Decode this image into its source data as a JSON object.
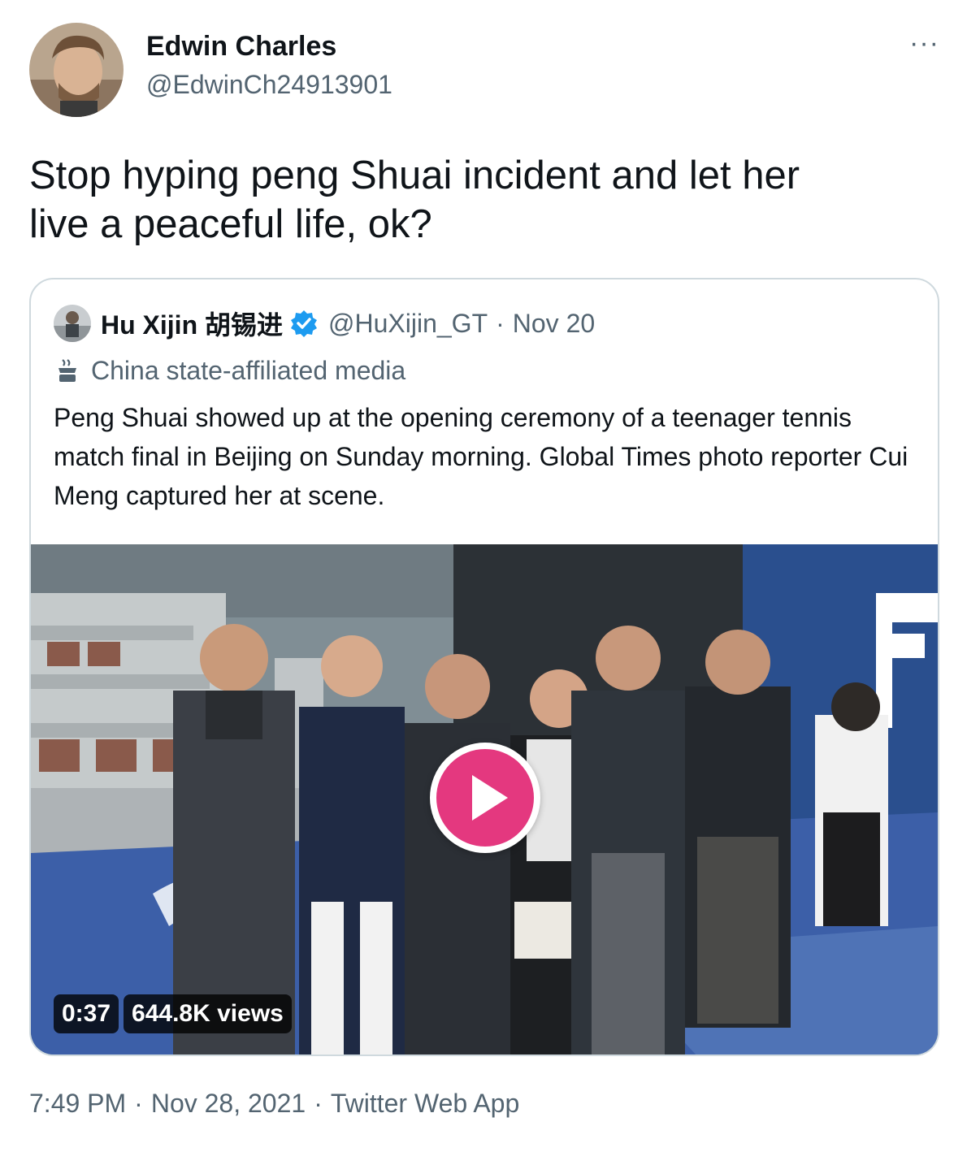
{
  "author": {
    "name": "Edwin Charles",
    "handle": "@EdwinCh24913901",
    "avatar_icon": "user-avatar-photo"
  },
  "more_icon": "more-options-icon",
  "more_label": "···",
  "tweet": {
    "text": "Stop hyping peng Shuai incident and let her\nlive a peaceful life, ok?"
  },
  "quoted": {
    "name": "Hu Xijin 胡锡进",
    "verified_icon": "verified-badge-icon",
    "handle": "@HuXijin_GT",
    "separator": "·",
    "date": "Nov 20",
    "label_icon": "state-media-icon",
    "label": "China state-affiliated media",
    "text": "Peng Shuai showed up at the opening ceremony of a teenager tennis match final in Beijing on Sunday morning. Global Times photo reporter Cui Meng captured her at scene.",
    "video": {
      "duration": "0:37",
      "views": "644.8K views",
      "play_icon": "play-icon"
    }
  },
  "footer": {
    "time": "7:49 PM",
    "date": "Nov 28, 2021",
    "source": "Twitter Web App",
    "separator": "·"
  },
  "colors": {
    "text": "#0f1419",
    "secondary": "#536471",
    "border": "#cfd9de",
    "verified": "#1d9bf0",
    "play": "#e4387f"
  }
}
